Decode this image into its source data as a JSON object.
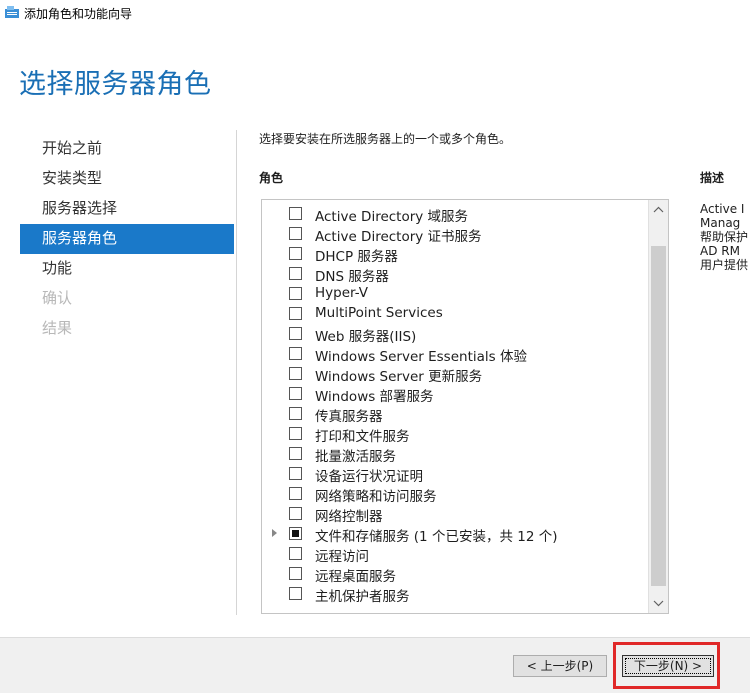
{
  "window": {
    "title": "添加角色和功能向导",
    "icon": "server-manager-icon"
  },
  "page_title": "选择服务器角色",
  "nav": {
    "items": [
      {
        "label": "开始之前",
        "state": "normal"
      },
      {
        "label": "安装类型",
        "state": "normal"
      },
      {
        "label": "服务器选择",
        "state": "normal"
      },
      {
        "label": "服务器角色",
        "state": "active"
      },
      {
        "label": "功能",
        "state": "normal"
      },
      {
        "label": "确认",
        "state": "disabled"
      },
      {
        "label": "结果",
        "state": "disabled"
      }
    ]
  },
  "main": {
    "instruction": "选择要安装在所选服务器上的一个或多个角色。",
    "roles_header": "角色",
    "description_header": "描述",
    "description_text": "Active I\nManag\n帮助保护\nAD RM\n用户提供",
    "roles": [
      {
        "label": "Active Directory 域服务",
        "checked": false,
        "expandable": false
      },
      {
        "label": "Active Directory 证书服务",
        "checked": false,
        "expandable": false
      },
      {
        "label": "DHCP 服务器",
        "checked": false,
        "expandable": false
      },
      {
        "label": "DNS 服务器",
        "checked": false,
        "expandable": false
      },
      {
        "label": "Hyper-V",
        "checked": false,
        "expandable": false
      },
      {
        "label": "MultiPoint Services",
        "checked": false,
        "expandable": false
      },
      {
        "label": "Web 服务器(IIS)",
        "checked": false,
        "expandable": false
      },
      {
        "label": "Windows Server Essentials 体验",
        "checked": false,
        "expandable": false
      },
      {
        "label": "Windows Server 更新服务",
        "checked": false,
        "expandable": false
      },
      {
        "label": "Windows 部署服务",
        "checked": false,
        "expandable": false
      },
      {
        "label": "传真服务器",
        "checked": false,
        "expandable": false
      },
      {
        "label": "打印和文件服务",
        "checked": false,
        "expandable": false
      },
      {
        "label": "批量激活服务",
        "checked": false,
        "expandable": false
      },
      {
        "label": "设备运行状况证明",
        "checked": false,
        "expandable": false
      },
      {
        "label": "网络策略和访问服务",
        "checked": false,
        "expandable": false
      },
      {
        "label": "网络控制器",
        "checked": false,
        "expandable": false
      },
      {
        "label": "文件和存储服务 (1 个已安装，共 12 个)",
        "checked": "partial",
        "expandable": true
      },
      {
        "label": "远程访问",
        "checked": false,
        "expandable": false
      },
      {
        "label": "远程桌面服务",
        "checked": false,
        "expandable": false
      },
      {
        "label": "主机保护者服务",
        "checked": false,
        "expandable": false
      }
    ]
  },
  "footer": {
    "prev_label": "< 上一步(P)",
    "next_label": "下一步(N) >",
    "highlight_color": "#e02828"
  },
  "colors": {
    "accent": "#1a79c9",
    "title": "#1a6fb5"
  }
}
